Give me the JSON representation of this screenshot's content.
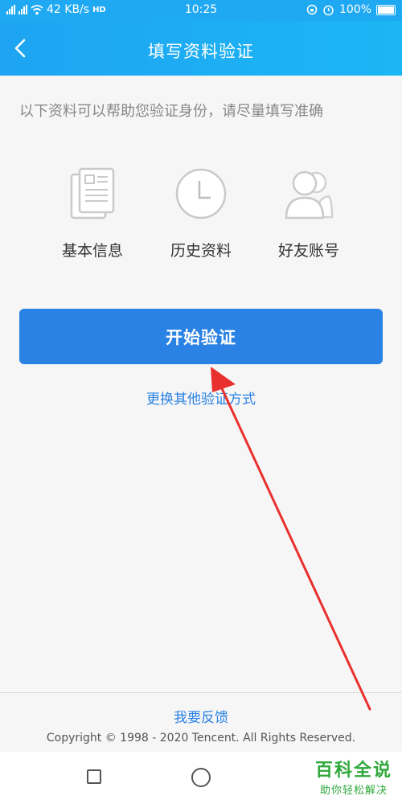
{
  "status_bar": {
    "network": "4G",
    "network2": "2G",
    "speed": "42 KB/s",
    "hd": "HD",
    "time": "10:25",
    "battery": "100%"
  },
  "header": {
    "title": "填写资料验证",
    "back_icon": "chevron-left-icon"
  },
  "intro_text": "以下资料可以帮助您验证身份，请尽量填写准确",
  "options": [
    {
      "label": "基本信息",
      "icon": "document-icon"
    },
    {
      "label": "历史资料",
      "icon": "clock-icon"
    },
    {
      "label": "好友账号",
      "icon": "friends-icon"
    }
  ],
  "primary_button": "开始验证",
  "secondary_link": "更换其他验证方式",
  "footer": {
    "feedback": "我要反馈",
    "copyright": "Copyright © 1998 - 2020 Tencent. All Rights Reserved."
  },
  "watermark": {
    "main": "百科全说",
    "sub": "助你轻松解决"
  },
  "colors": {
    "header": "#1fa9f2",
    "primary": "#2a82e4",
    "arrow": "#e8312f",
    "watermark": "#2fa83c"
  }
}
